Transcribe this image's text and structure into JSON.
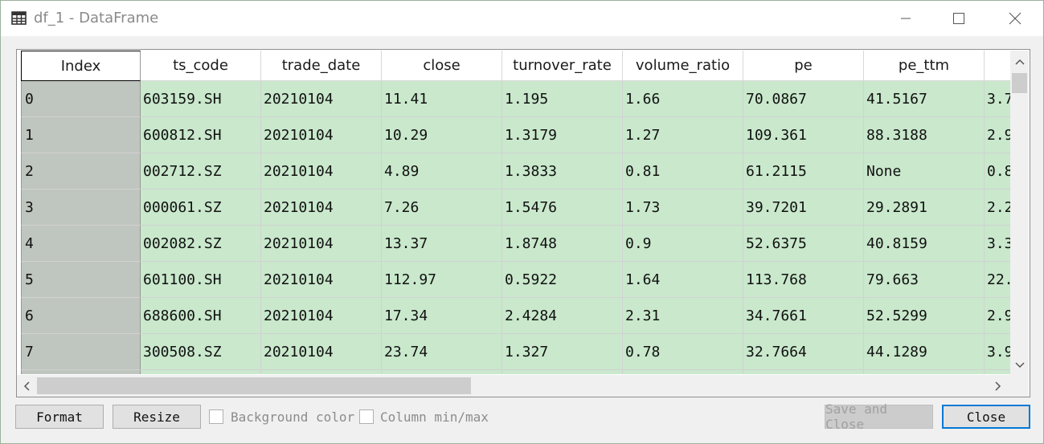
{
  "window": {
    "title": "df_1 - DataFrame",
    "icon": "table-icon"
  },
  "table": {
    "columns": [
      "Index",
      "ts_code",
      "trade_date",
      "close",
      "turnover_rate",
      "volume_ratio",
      "pe",
      "pe_ttm"
    ],
    "partial_column_values": [
      "3.7",
      "2.9",
      "0.8",
      "2.2",
      "3.3",
      "22.",
      "2.9",
      "3.9"
    ],
    "rows": [
      [
        "0",
        "603159.SH",
        "20210104",
        "11.41",
        "1.195",
        "1.66",
        "70.0867",
        "41.5167"
      ],
      [
        "1",
        "600812.SH",
        "20210104",
        "10.29",
        "1.3179",
        "1.27",
        "109.361",
        "88.3188"
      ],
      [
        "2",
        "002712.SZ",
        "20210104",
        "4.89",
        "1.3833",
        "0.81",
        "61.2115",
        "None"
      ],
      [
        "3",
        "000061.SZ",
        "20210104",
        "7.26",
        "1.5476",
        "1.73",
        "39.7201",
        "29.2891"
      ],
      [
        "4",
        "002082.SZ",
        "20210104",
        "13.37",
        "1.8748",
        "0.9",
        "52.6375",
        "40.8159"
      ],
      [
        "5",
        "601100.SH",
        "20210104",
        "112.97",
        "0.5922",
        "1.64",
        "113.768",
        "79.663"
      ],
      [
        "6",
        "688600.SH",
        "20210104",
        "17.34",
        "2.4284",
        "2.31",
        "34.7661",
        "52.5299"
      ],
      [
        "7",
        "300508.SZ",
        "20210104",
        "23.74",
        "1.327",
        "0.78",
        "32.7664",
        "44.1289"
      ]
    ]
  },
  "buttons": {
    "format": "Format",
    "resize": "Resize",
    "save_close": "Save and Close",
    "close": "Close"
  },
  "checkboxes": {
    "background_color": "Background color",
    "column_minmax": "Column min/max"
  }
}
